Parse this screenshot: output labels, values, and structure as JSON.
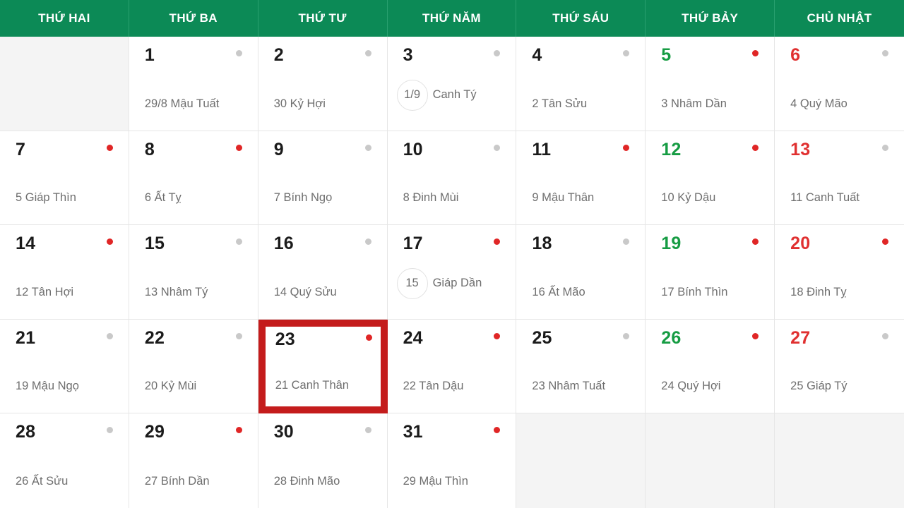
{
  "header": {
    "weekdays": [
      "THỨ HAI",
      "THỨ BA",
      "THỨ TƯ",
      "THỨ NĂM",
      "THỨ SÁU",
      "THỨ BẢY",
      "CHỦ NHẬT"
    ]
  },
  "colors": {
    "header_bg": "#0c8a56",
    "saturday": "#169c43",
    "sunday": "#e03030",
    "dot_red": "#e02626",
    "dot_gray": "#c9c9c9",
    "highlight_border": "#c41c1c",
    "empty_cell_bg": "#f4f4f4"
  },
  "weeks": [
    [
      {
        "empty": true
      },
      {
        "solar": "1",
        "lunar": "29/8 Mậu Tuất",
        "badge": "",
        "dot": "gray"
      },
      {
        "solar": "2",
        "lunar": "30 Kỷ Hợi",
        "badge": "",
        "dot": "gray"
      },
      {
        "solar": "3",
        "lunar": "Canh Tý",
        "badge": "1/9",
        "dot": "gray"
      },
      {
        "solar": "4",
        "lunar": "2 Tân Sửu",
        "badge": "",
        "dot": "gray"
      },
      {
        "solar": "5",
        "lunar": "3 Nhâm Dần",
        "badge": "",
        "dot": "red",
        "color": "sat"
      },
      {
        "solar": "6",
        "lunar": "4 Quý Mão",
        "badge": "",
        "dot": "gray",
        "color": "sun"
      }
    ],
    [
      {
        "solar": "7",
        "lunar": "5 Giáp Thìn",
        "badge": "",
        "dot": "red"
      },
      {
        "solar": "8",
        "lunar": "6 Ất Tỵ",
        "badge": "",
        "dot": "red"
      },
      {
        "solar": "9",
        "lunar": "7 Bính Ngọ",
        "badge": "",
        "dot": "gray"
      },
      {
        "solar": "10",
        "lunar": "8 Đinh Mùi",
        "badge": "",
        "dot": "gray"
      },
      {
        "solar": "11",
        "lunar": "9 Mậu Thân",
        "badge": "",
        "dot": "red"
      },
      {
        "solar": "12",
        "lunar": "10 Kỷ Dậu",
        "badge": "",
        "dot": "red",
        "color": "sat"
      },
      {
        "solar": "13",
        "lunar": "11 Canh Tuất",
        "badge": "",
        "dot": "gray",
        "color": "sun"
      }
    ],
    [
      {
        "solar": "14",
        "lunar": "12 Tân Hợi",
        "badge": "",
        "dot": "red"
      },
      {
        "solar": "15",
        "lunar": "13 Nhâm Tý",
        "badge": "",
        "dot": "gray"
      },
      {
        "solar": "16",
        "lunar": "14 Quý Sửu",
        "badge": "",
        "dot": "gray"
      },
      {
        "solar": "17",
        "lunar": "Giáp Dần",
        "badge": "15",
        "dot": "red"
      },
      {
        "solar": "18",
        "lunar": "16 Ất Mão",
        "badge": "",
        "dot": "gray"
      },
      {
        "solar": "19",
        "lunar": "17 Bính Thìn",
        "badge": "",
        "dot": "red",
        "color": "sat"
      },
      {
        "solar": "20",
        "lunar": "18 Đinh Tỵ",
        "badge": "",
        "dot": "red",
        "color": "sun"
      }
    ],
    [
      {
        "solar": "21",
        "lunar": "19 Mậu Ngọ",
        "badge": "",
        "dot": "gray"
      },
      {
        "solar": "22",
        "lunar": "20 Kỷ Mùi",
        "badge": "",
        "dot": "gray"
      },
      {
        "solar": "23",
        "lunar": "21 Canh Thân",
        "badge": "",
        "dot": "red",
        "highlight": true
      },
      {
        "solar": "24",
        "lunar": "22 Tân Dậu",
        "badge": "",
        "dot": "red"
      },
      {
        "solar": "25",
        "lunar": "23 Nhâm Tuất",
        "badge": "",
        "dot": "gray"
      },
      {
        "solar": "26",
        "lunar": "24 Quý Hợi",
        "badge": "",
        "dot": "red",
        "color": "sat"
      },
      {
        "solar": "27",
        "lunar": "25 Giáp Tý",
        "badge": "",
        "dot": "gray",
        "color": "sun"
      }
    ],
    [
      {
        "solar": "28",
        "lunar": "26 Ất Sửu",
        "badge": "",
        "dot": "gray"
      },
      {
        "solar": "29",
        "lunar": "27 Bính Dần",
        "badge": "",
        "dot": "red"
      },
      {
        "solar": "30",
        "lunar": "28 Đinh Mão",
        "badge": "",
        "dot": "gray"
      },
      {
        "solar": "31",
        "lunar": "29 Mậu Thìn",
        "badge": "",
        "dot": "red"
      },
      {
        "empty": true
      },
      {
        "empty": true
      },
      {
        "empty": true
      }
    ]
  ]
}
